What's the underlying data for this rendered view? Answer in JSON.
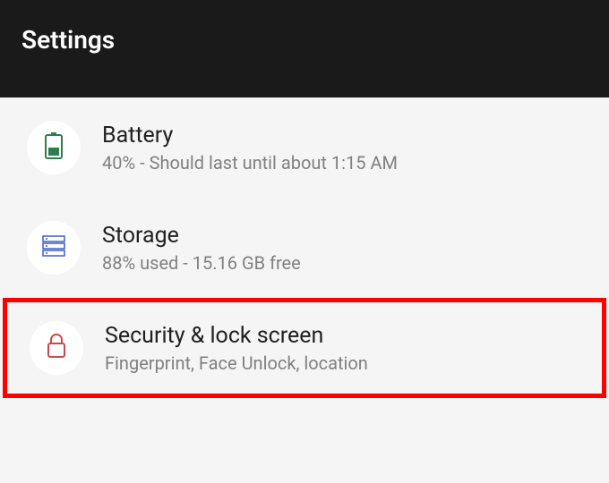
{
  "header": {
    "title": "Settings"
  },
  "items": [
    {
      "title": "Battery",
      "subtitle": "40% - Should last until about 1:15 AM"
    },
    {
      "title": "Storage",
      "subtitle": "88% used - 15.16 GB free"
    },
    {
      "title": "Security & lock screen",
      "subtitle": "Fingerprint, Face Unlock, location"
    }
  ]
}
